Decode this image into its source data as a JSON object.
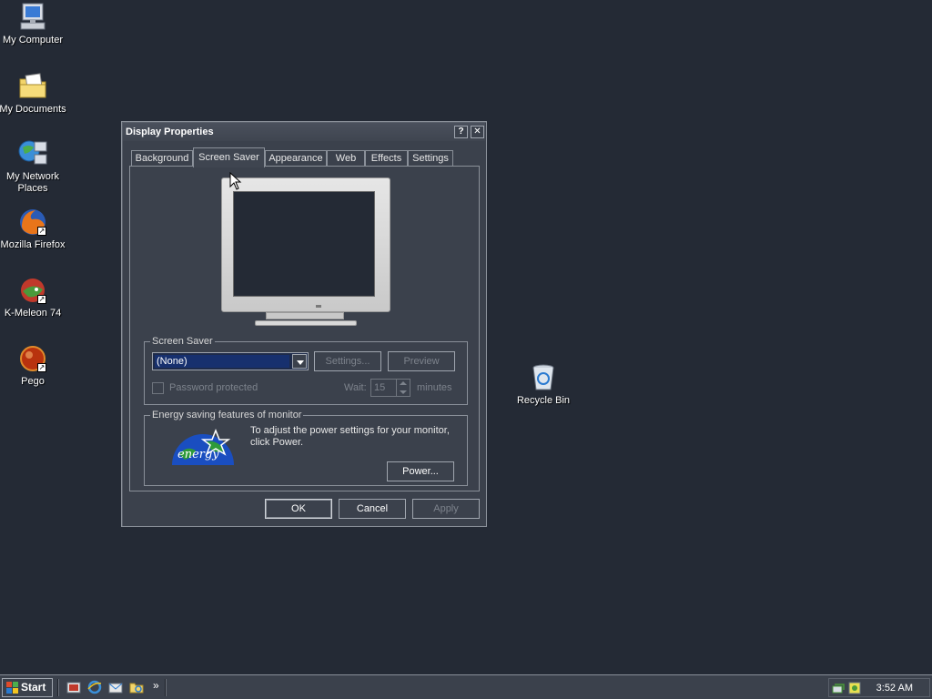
{
  "desktop": {
    "icons": [
      {
        "label": "My Computer",
        "icon": "my-computer-icon"
      },
      {
        "label": "My Documents",
        "icon": "my-documents-icon"
      },
      {
        "label": "My Network Places",
        "icon": "network-places-icon"
      },
      {
        "label": "Mozilla Firefox",
        "icon": "firefox-icon"
      },
      {
        "label": "K-Meleon 74",
        "icon": "k-meleon-icon"
      },
      {
        "label": "Pego",
        "icon": "pego-icon"
      },
      {
        "label": "Recycle Bin",
        "icon": "recycle-bin-icon"
      }
    ]
  },
  "window": {
    "title": "Display Properties",
    "help_btn": "?",
    "close_btn": "✕",
    "tabs": [
      {
        "label": "Background"
      },
      {
        "label": "Screen Saver",
        "active": true
      },
      {
        "label": "Appearance"
      },
      {
        "label": "Web"
      },
      {
        "label": "Effects"
      },
      {
        "label": "Settings"
      }
    ],
    "screensaver": {
      "group_title": "Screen Saver",
      "selected": "(None)",
      "settings_label": "Settings...",
      "preview_label": "Preview",
      "password_label": "Password protected",
      "wait_label": "Wait:",
      "wait_value": "15",
      "minutes_label": "minutes"
    },
    "energy": {
      "group_title": "Energy saving features of monitor",
      "text": "To adjust the power settings for your monitor, click Power.",
      "logo_text": "energy",
      "power_label": "Power..."
    },
    "buttons": {
      "ok": "OK",
      "cancel": "Cancel",
      "apply": "Apply"
    }
  },
  "taskbar": {
    "start_label": "Start",
    "chevron": "»",
    "clock": "3:52 AM"
  }
}
